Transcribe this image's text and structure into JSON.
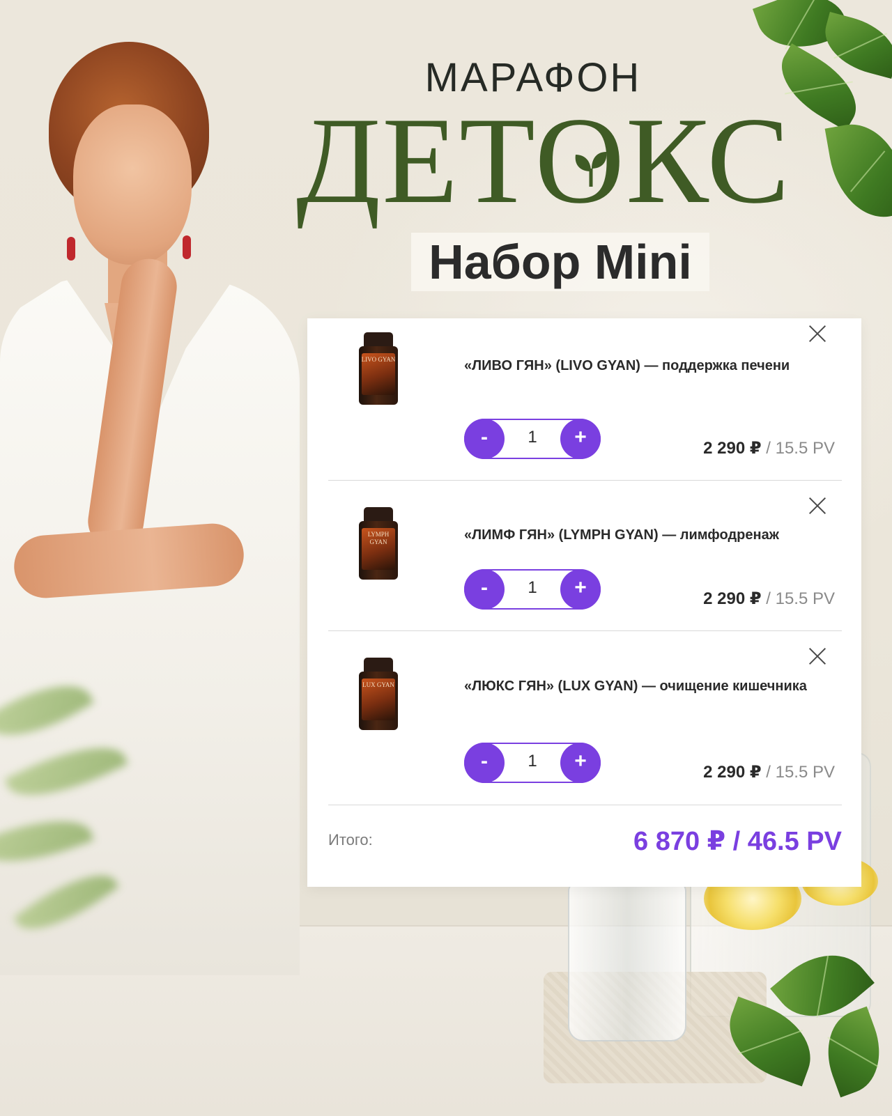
{
  "header": {
    "title_small": "МАРАФОН",
    "title_big": "ДЕТОКС",
    "subtitle": "Набор Mini"
  },
  "cart": {
    "items": [
      {
        "name": "«ЛИВО ГЯН» (LIVO GYAN) — поддержка печени",
        "bottle_label": "LIVO GYAN",
        "quantity": "1",
        "price": "2 290 ₽",
        "pv": "/ 15.5 PV",
        "minus_label": "-",
        "plus_label": "+"
      },
      {
        "name": "«ЛИМФ ГЯН» (LYMPH GYAN) — лимфодренаж",
        "bottle_label": "LYMPH GYAN",
        "quantity": "1",
        "price": "2 290 ₽",
        "pv": "/ 15.5 PV",
        "minus_label": "-",
        "plus_label": "+"
      },
      {
        "name": "«ЛЮКС ГЯН» (LUX GYAN) — очищение кишечника",
        "bottle_label": "LUX GYAN",
        "quantity": "1",
        "price": "2 290 ₽",
        "pv": "/ 15.5 PV",
        "minus_label": "-",
        "plus_label": "+"
      }
    ],
    "total_label": "Итого:",
    "total_value": "6 870 ₽ / 46.5 PV"
  },
  "colors": {
    "accent": "#7a3fe0",
    "title_green": "#3f5b25",
    "text_dark": "#2a2a2a",
    "pv_grey": "#8a8a8a"
  },
  "icons": [
    "close-icon",
    "sprout-icon",
    "product-bottle"
  ]
}
